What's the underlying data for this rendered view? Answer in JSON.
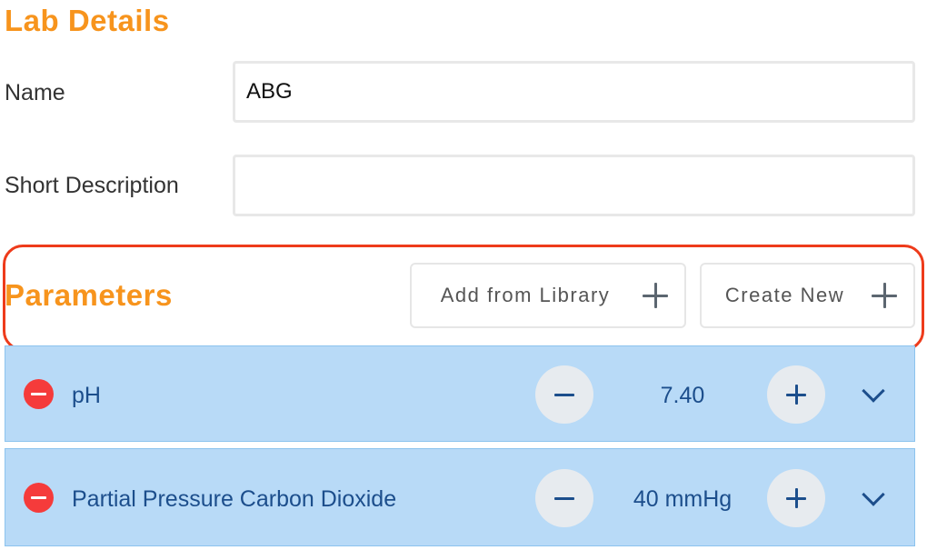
{
  "lab_details": {
    "title": "Lab Details",
    "name_label": "Name",
    "name_value": "ABG",
    "short_description_label": "Short Description",
    "short_description_value": ""
  },
  "parameters": {
    "title": "Parameters",
    "add_from_library_label": "Add from Library",
    "create_new_label": "Create New",
    "items": [
      {
        "name": "pH",
        "value": "7.40"
      },
      {
        "name": "Partial Pressure Carbon Dioxide",
        "value": "40 mmHg"
      }
    ]
  },
  "colors": {
    "accent_orange": "#f7941d",
    "highlight_red": "#ee3b1b",
    "row_background": "#b8daf7",
    "text_blue": "#1c4e8c",
    "remove_red": "#f53b3b"
  },
  "icons": {
    "remove": "minus-circle-icon",
    "decrement": "minus-icon",
    "increment": "plus-icon",
    "expand": "chevron-down-icon",
    "add": "plus-icon"
  }
}
